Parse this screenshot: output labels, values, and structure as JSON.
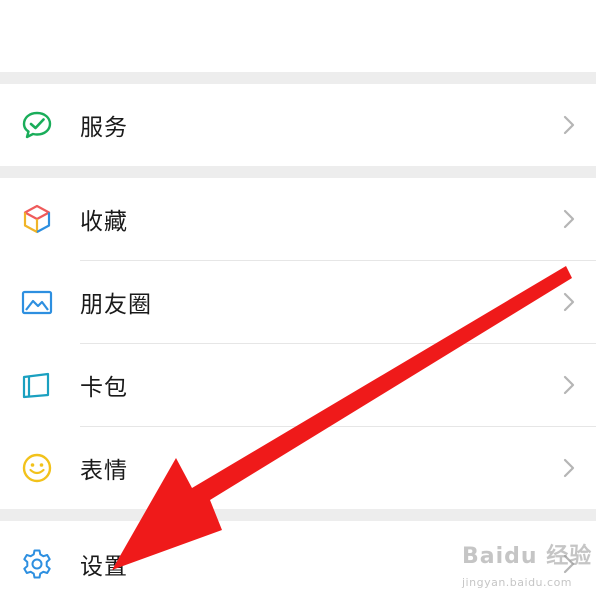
{
  "menu": {
    "items": [
      {
        "label": "服务",
        "icon": "wechat-pay-icon"
      },
      {
        "label": "收藏",
        "icon": "cube-icon"
      },
      {
        "label": "朋友圈",
        "icon": "picture-icon"
      },
      {
        "label": "卡包",
        "icon": "wallet-icon"
      },
      {
        "label": "表情",
        "icon": "smile-icon"
      },
      {
        "label": "设置",
        "icon": "gear-icon"
      }
    ]
  },
  "watermark": {
    "main": "Baidu 经验",
    "sub": "jingyan.baidu.com"
  },
  "colors": {
    "arrow": "#ef1a1a",
    "separator": "#ededed",
    "chevron": "#b5b5b5",
    "text": "#1a1a1a"
  }
}
